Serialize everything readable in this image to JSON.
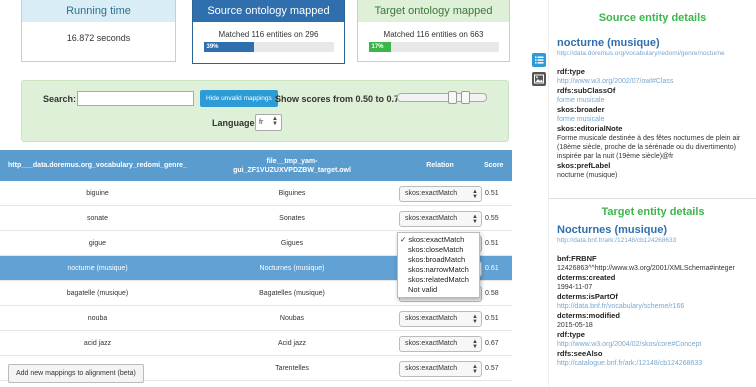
{
  "stats": {
    "running": {
      "title": "Running time",
      "value": "16.872 seconds"
    },
    "source": {
      "title": "Source ontology mapped",
      "text": "Matched 116 entities on 296",
      "percent_label": "39%",
      "percent": 39
    },
    "target": {
      "title": "Target ontology mapped",
      "text": "Matched 116 entities on 663",
      "percent_label": "17%",
      "percent": 17
    }
  },
  "filter": {
    "search_label": "Search:",
    "search_value": "",
    "hide_button": "Hide unvalid mappings",
    "scores_label": "Show scores from 0.50 to 0.70",
    "score_min": 0.5,
    "score_max": 0.7,
    "language_label": "Language:",
    "language_value": "fr"
  },
  "table": {
    "headers": {
      "source": "http___data.doremus.org_vocabulary_redomi_genre_",
      "target": "file__tmp_yam-gui_ZF1VUZUXVPDZBW_target.owl",
      "relation": "Relation",
      "score": "Score"
    },
    "rows": [
      {
        "source": "biguine",
        "target": "Biguines",
        "relation": "skos:exactMatch",
        "score": "0.51"
      },
      {
        "source": "sonate",
        "target": "Sonates",
        "relation": "skos:exactMatch",
        "score": "0.55"
      },
      {
        "source": "gigue",
        "target": "Gigues",
        "relation": "skos:exactMatch",
        "score": "0.51"
      },
      {
        "source": "nocturne (musique)",
        "target": "Nocturnes (musique)",
        "relation": "skos:exactMatch",
        "score": "0.61"
      },
      {
        "source": "bagatelle (musique)",
        "target": "Bagatelles (musique)",
        "relation": "skos:exactMatch",
        "score": "0.58"
      },
      {
        "source": "nouba",
        "target": "Noubas",
        "relation": "skos:exactMatch",
        "score": "0.51"
      },
      {
        "source": "acid jazz",
        "target": "Acid jazz",
        "relation": "skos:exactMatch",
        "score": "0.67"
      },
      {
        "source": "",
        "target": "Tarentelles",
        "relation": "skos:exactMatch",
        "score": "0.57"
      }
    ],
    "dropdown_options": [
      "skos:exactMatch",
      "skos:closeMatch",
      "skos:broadMatch",
      "skos:narrowMatch",
      "skos:relatedMatch",
      "Not valid"
    ],
    "checked_mark": "✓"
  },
  "add_button": "Add new mappings to alignment (beta)",
  "source_details": {
    "title": "Source entity details",
    "name": "nocturne (musique)",
    "uri": "http://data.doremus.org/vocabulary/redomi/genre/nocturne",
    "props": [
      {
        "label": "rdf:type",
        "values": [
          "http://www.w3.org/2002/07/owl#Class"
        ],
        "link": true
      },
      {
        "label": "rdfs:subClassOf",
        "values": [
          "forme musicale"
        ],
        "link": true
      },
      {
        "label": "skos:broader",
        "values": [
          "forme musicale"
        ],
        "link": true
      },
      {
        "label": "skos:editorialNote",
        "values": [
          "Forme musicale destinée à des fêtes nocturnes de plein air",
          "(18ème siècle, proche de la sérénade ou du divertimento)",
          "inspirée par la nuit (19ème siècle)@fr"
        ],
        "link": false
      },
      {
        "label": "skos:prefLabel",
        "values": [
          "nocturne (musique)"
        ],
        "link": false
      }
    ]
  },
  "target_details": {
    "title": "Target entity details",
    "name": "Nocturnes (musique)",
    "uri": "http://data.bnf.fr/ark:/12148/cb124268633",
    "props": [
      {
        "label": "bnf:FRBNF",
        "values": [
          "12426863^^http://www.w3.org/2001/XMLSchema#integer"
        ],
        "link": false
      },
      {
        "label": "dcterms:created",
        "values": [
          "1994-11-07"
        ],
        "link": false
      },
      {
        "label": "dcterms:isPartOf",
        "values": [
          "http://data.bnf.fr/vocabulary/scheme/r166"
        ],
        "link": true
      },
      {
        "label": "dcterms:modified",
        "values": [
          "2015-05-18"
        ],
        "link": false
      },
      {
        "label": "rdf:type",
        "values": [
          "http://www.w3.org/2004/02/skos/core#Concept"
        ],
        "link": true
      },
      {
        "label": "rdfs:seeAlso",
        "values": [
          "http://catalogue.bnf.fr/ark:/12148/cb124268633"
        ],
        "link": true
      }
    ]
  },
  "colors": {
    "primary": "#2f6fad",
    "success": "#3cb64a",
    "info": "#2d9bd6",
    "table_header": "#5b9ccf",
    "selected_row": "#62a1d3"
  }
}
